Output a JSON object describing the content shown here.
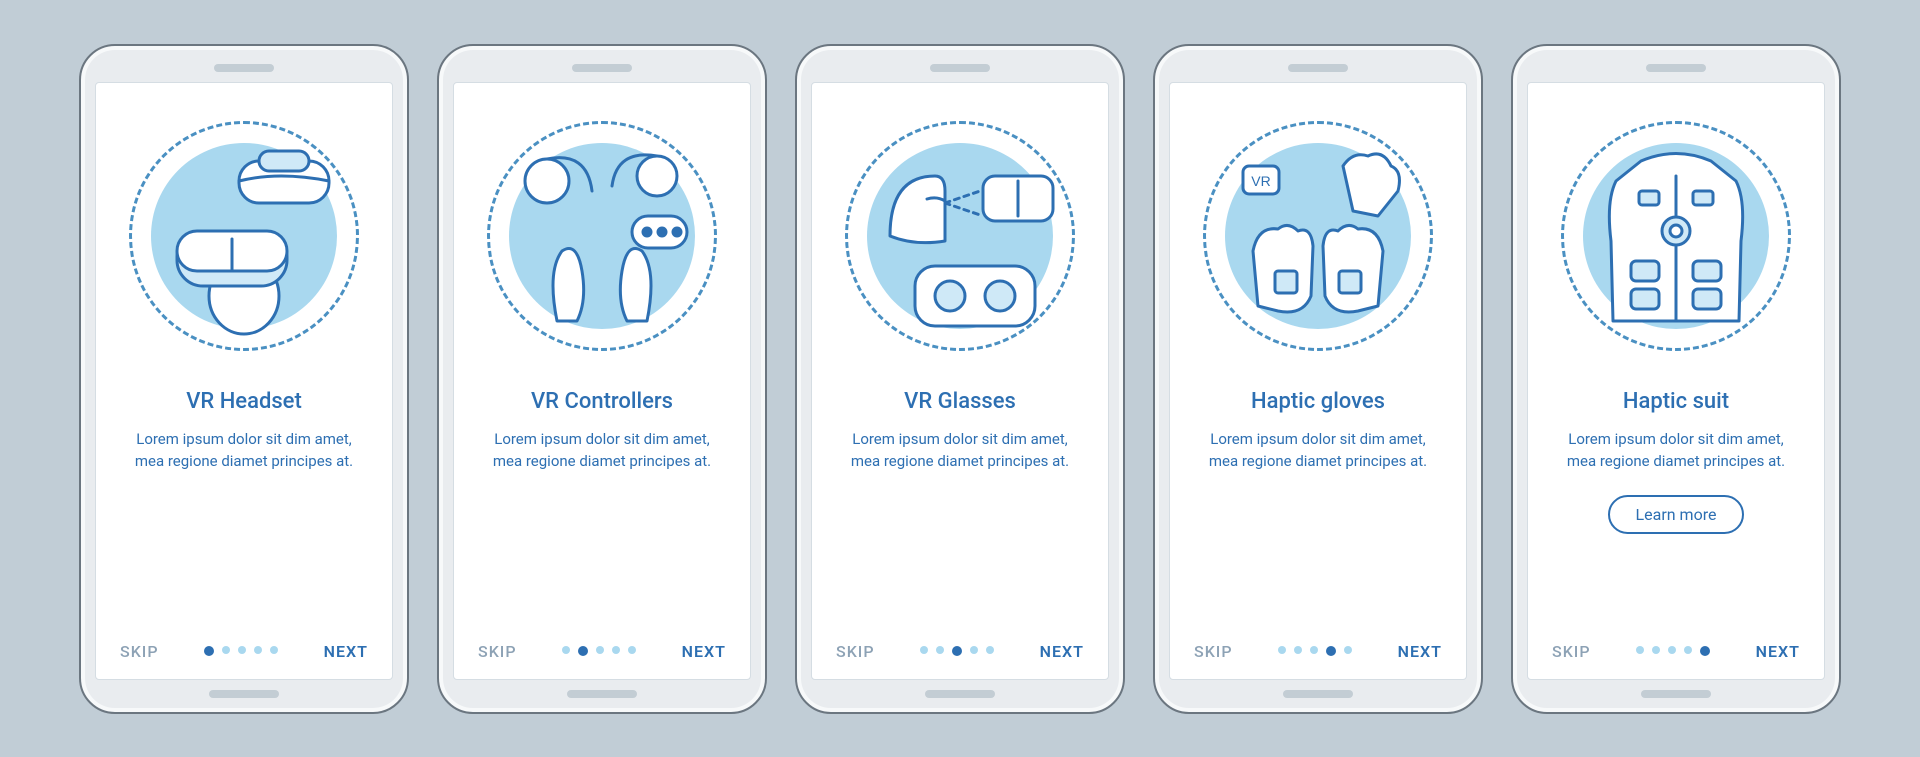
{
  "common": {
    "skip_label": "SKIP",
    "next_label": "NEXT",
    "learn_more_label": "Learn more",
    "lorem": "Lorem ipsum dolor sit dim amet, mea regione diamet principes at."
  },
  "screens": [
    {
      "title": "VR Headset",
      "icon": "vr-headset-icon",
      "active_dot": 0,
      "has_cta": false
    },
    {
      "title": "VR Controllers",
      "icon": "vr-controllers-icon",
      "active_dot": 1,
      "has_cta": false
    },
    {
      "title": "VR Glasses",
      "icon": "vr-glasses-icon",
      "active_dot": 2,
      "has_cta": false
    },
    {
      "title": "Haptic gloves",
      "icon": "haptic-gloves-icon",
      "active_dot": 3,
      "has_cta": false
    },
    {
      "title": "Haptic suit",
      "icon": "haptic-suit-icon",
      "active_dot": 4,
      "has_cta": true
    }
  ],
  "total_dots": 5,
  "colors": {
    "background": "#c1cdd6",
    "accent": "#2d6fb2",
    "accent_light": "#a9d8ef"
  }
}
